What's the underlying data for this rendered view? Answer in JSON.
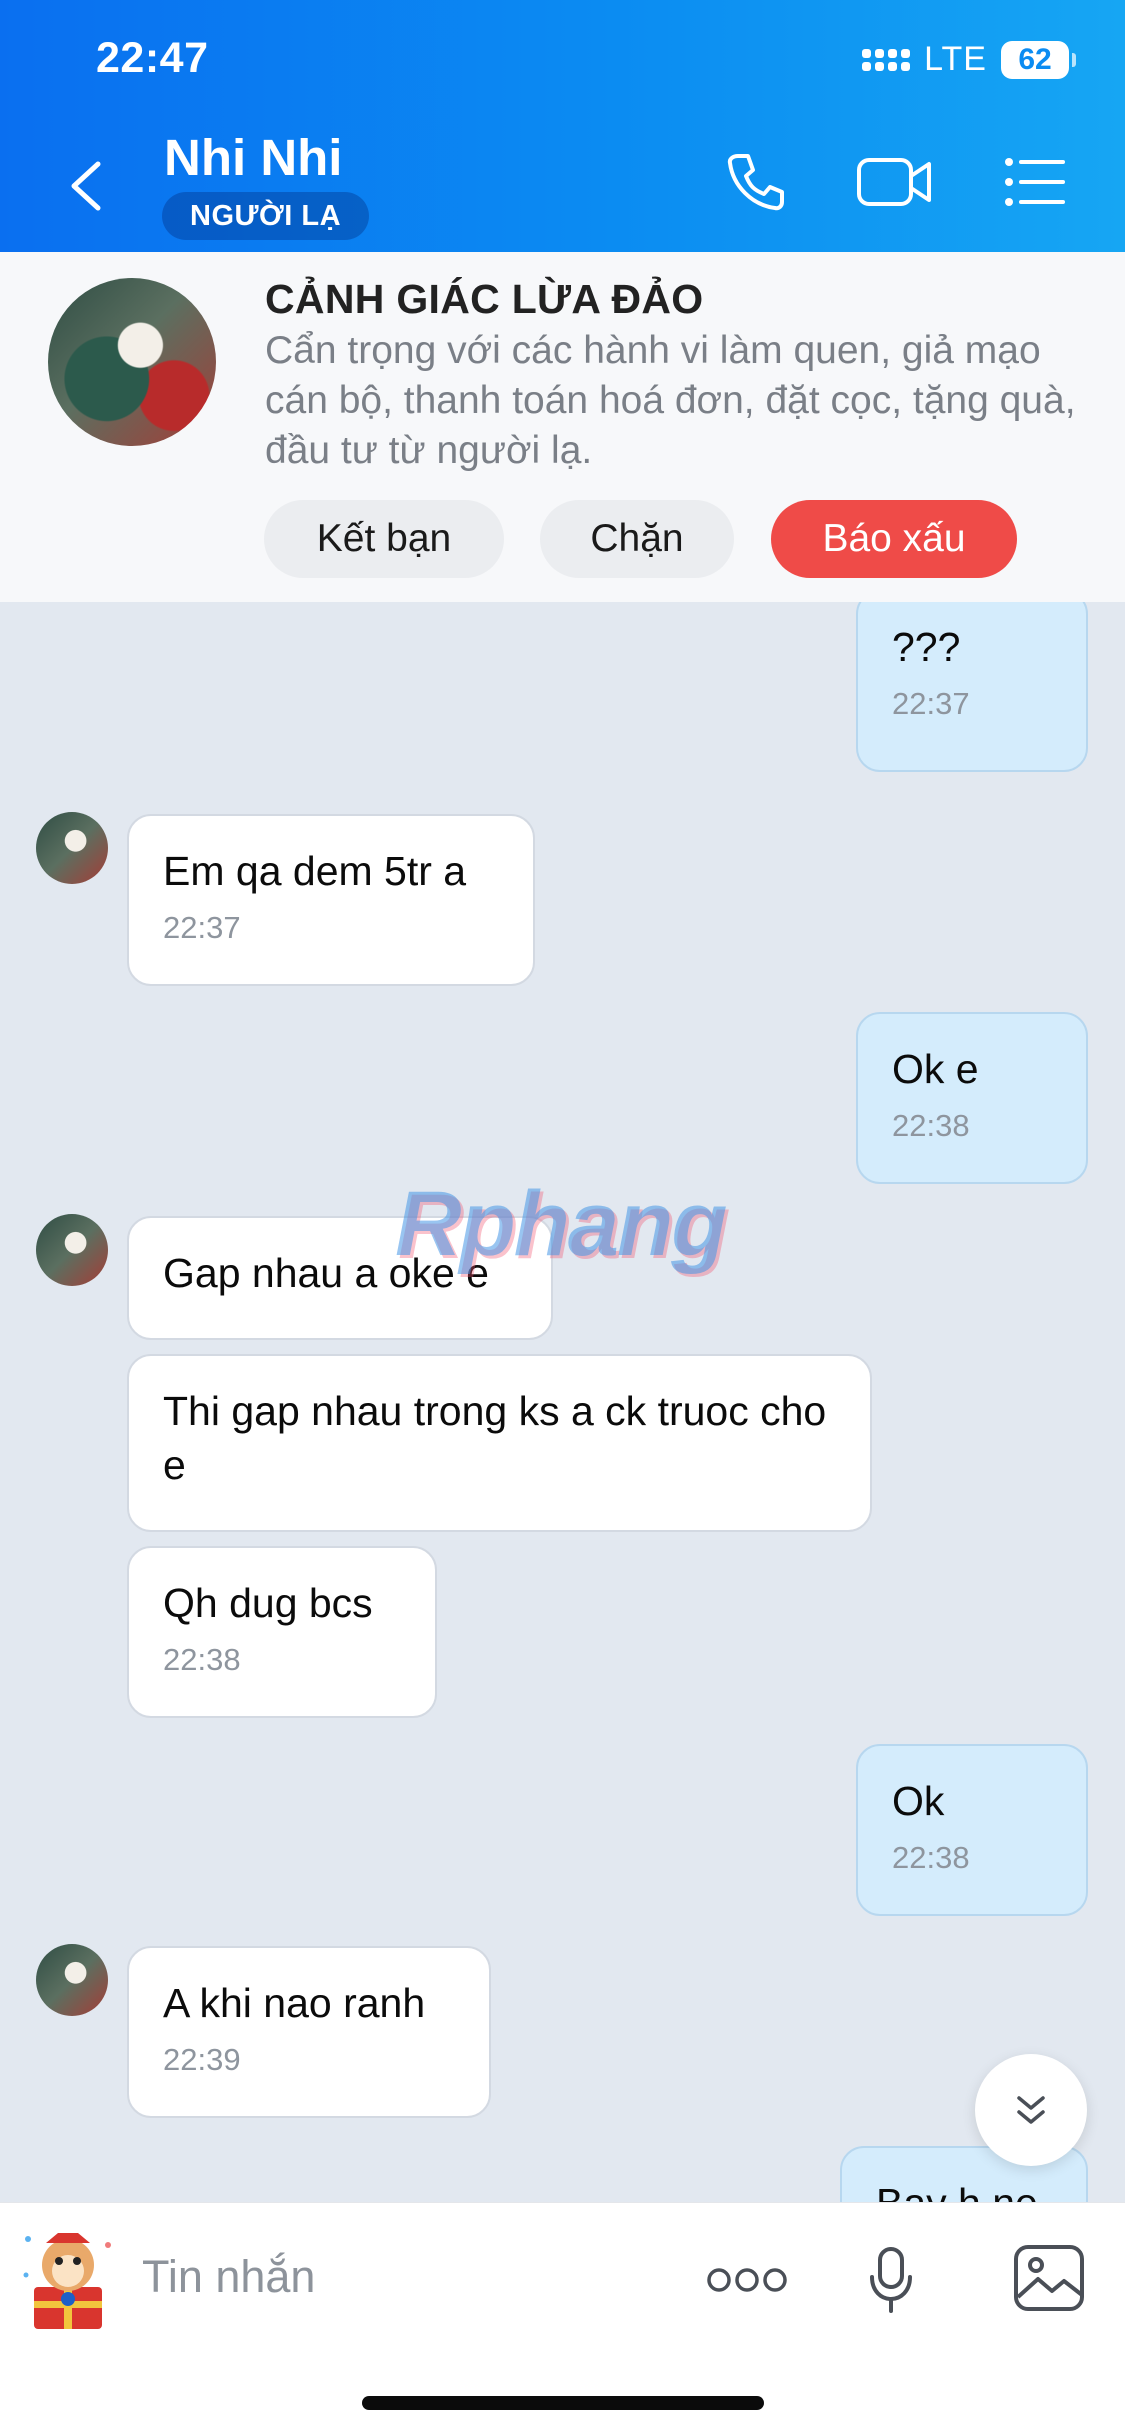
{
  "status_bar": {
    "time": "22:47",
    "network": "LTE",
    "battery": "62"
  },
  "header": {
    "contact_name": "Nhi Nhi",
    "badge": "NGƯỜI LẠ",
    "icons": [
      "chevron-left-icon",
      "phone-icon",
      "video-call-icon",
      "list-menu-icon"
    ]
  },
  "warning": {
    "title": "CẢNH GIÁC LỪA ĐẢO",
    "text": "Cẩn trọng với các hành vi làm quen, giả mạo cán bộ, thanh toán hoá đơn, đặt cọc, tặng quà, đầu tư từ người lạ.",
    "buttons": {
      "add_friend": "Kết bạn",
      "block": "Chặn",
      "report": "Báo xấu"
    }
  },
  "watermark": "Rphang",
  "messages": [
    {
      "dir": "out",
      "text": "???",
      "time": "22:37"
    },
    {
      "dir": "in",
      "text": "Em qa dem 5tr a",
      "time": "22:37"
    },
    {
      "dir": "out",
      "text": "Ok e",
      "time": "22:38"
    },
    {
      "dir": "in",
      "text": "Gap nhau a oke e",
      "time": ""
    },
    {
      "dir": "in",
      "text": "Thi gap nhau trong ks a ck truoc cho e",
      "time": ""
    },
    {
      "dir": "in",
      "text": "Qh dug bcs",
      "time": "22:38"
    },
    {
      "dir": "out",
      "text": "Ok",
      "time": "22:38"
    },
    {
      "dir": "in",
      "text": "A khi nao ranh",
      "time": "22:39"
    },
    {
      "dir": "out",
      "text": "Bay h ne",
      "time": ""
    }
  ],
  "composer": {
    "placeholder": "Tin nhắn",
    "icons": [
      "sticker-icon",
      "more-options-icon",
      "microphone-icon",
      "image-icon"
    ]
  },
  "colors": {
    "header": "#0b8cf2",
    "report_button": "#ef4b48",
    "outgoing_bubble": "#d4ecfc",
    "chat_background": "#e2e8f0"
  }
}
